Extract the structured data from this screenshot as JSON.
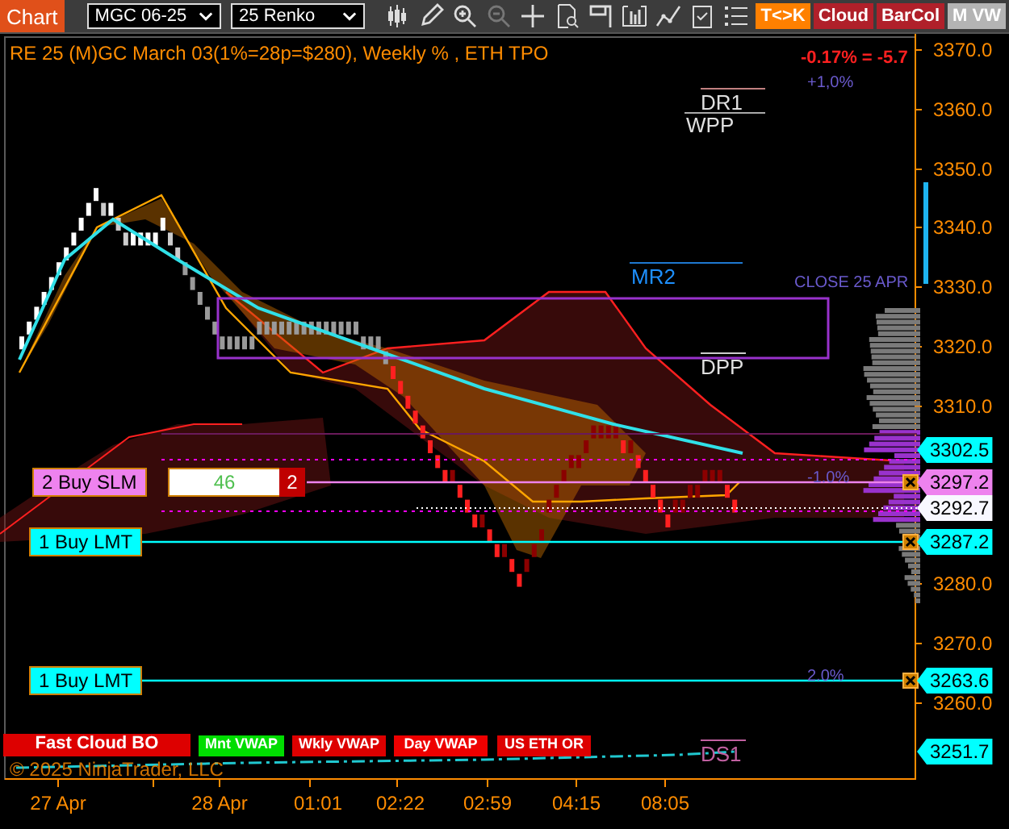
{
  "toolbar": {
    "app_button": "Chart",
    "instrument": "MGC 06-25",
    "bar_type": "25 Renko",
    "indicator_buttons": [
      {
        "label": "T<>K",
        "color": "#ff8000"
      },
      {
        "label": "Cloud",
        "color": "#b0202a"
      },
      {
        "label": "BarCol",
        "color": "#b0202a"
      },
      {
        "label": "M VW",
        "color": "#b4b4b4"
      }
    ]
  },
  "chart": {
    "title": "RE 25 (M)GC March 03(1%=28p=$280), Weekly % , ETH TPO",
    "change": "-0.17% = -5.7",
    "level_labels": [
      {
        "text": "DR1",
        "kind": "pivot"
      },
      {
        "text": "WPP",
        "kind": "pivot"
      },
      {
        "text": "+1,0%",
        "kind": "percent"
      },
      {
        "text": "MR2",
        "kind": "monthly"
      },
      {
        "text": "CLOSE 25 APR",
        "kind": "percent"
      },
      {
        "text": "DPP",
        "kind": "pivot"
      },
      {
        "text": "-1.0%",
        "kind": "percent"
      },
      {
        "text": "2.0%",
        "kind": "percent"
      },
      {
        "text": "DS1",
        "kind": "support"
      }
    ],
    "orders": [
      {
        "label": "2 Buy SLM",
        "kind": "stop",
        "quantity": "46",
        "count": "2"
      },
      {
        "label": "1 Buy LMT",
        "kind": "limit"
      },
      {
        "label": "1 Buy LMT",
        "kind": "limit"
      }
    ],
    "price_ticks": [
      "3370.0",
      "3360.0",
      "3350.0",
      "3340.0",
      "3330.0",
      "3320.0",
      "3310.0",
      "3280.0",
      "3270.0",
      "3260.0"
    ],
    "price_markers": [
      {
        "text": "3302.5",
        "color": "#00ffff"
      },
      {
        "text": "3297.2",
        "color": "#ee82ee"
      },
      {
        "text": "3292.7",
        "color": "#f8f8ff"
      },
      {
        "text": "3287.2",
        "color": "#00ffff"
      },
      {
        "text": "3263.6",
        "color": "#00ffff"
      },
      {
        "text": "3251.7",
        "color": "#00ffff"
      }
    ],
    "time_labels": [
      "27 Apr",
      "28 Apr",
      "01:01",
      "02:22",
      "02:59",
      "04:15",
      "08:05"
    ],
    "bottom_buttons": [
      {
        "label": "Fast Cloud BO",
        "color": "#dd0000"
      },
      {
        "label": "Mnt VWAP",
        "color": "#00dd00"
      },
      {
        "label": "Wkly VWAP",
        "color": "#dd0000"
      },
      {
        "label": "Day VWAP",
        "color": "#ee0000"
      },
      {
        "label": "US ETH OR",
        "color": "#dd0000"
      }
    ],
    "copyright": "© 2025 NinjaTrader, LLC"
  }
}
